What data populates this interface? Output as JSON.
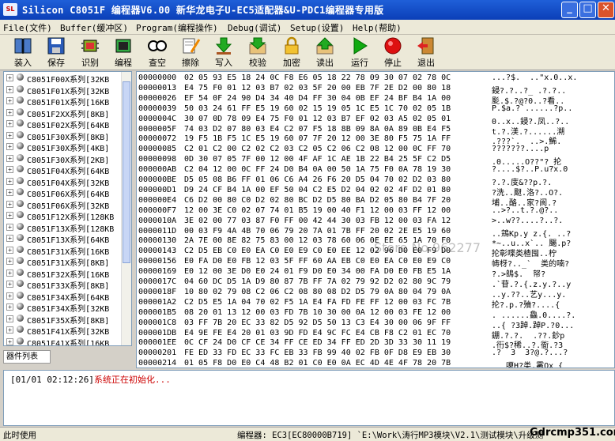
{
  "window": {
    "app_icon": "SL",
    "title": "Silicon C8051F 编程器V6.00  新华龙电子U-EC5适配器&U-PDC1编程器专用版"
  },
  "menu": [
    "File(文件)",
    "Buffer(缓冲区)",
    "Program(编程操作)",
    "Debug(调试)",
    "Setup(设置)",
    "Help(帮助)"
  ],
  "toolbar": [
    {
      "label": "装入",
      "icon": "book-icon"
    },
    {
      "label": "保存",
      "icon": "floppy-icon"
    },
    {
      "label": "识别",
      "icon": "chip-icon"
    },
    {
      "label": "编程",
      "icon": "program-icon"
    },
    {
      "label": "查空",
      "icon": "blank-check-icon"
    },
    {
      "label": "擦除",
      "icon": "erase-icon"
    },
    {
      "label": "写入",
      "icon": "write-arrow-icon"
    },
    {
      "label": "校验",
      "icon": "verify-icon"
    },
    {
      "label": "加密",
      "icon": "lock-icon"
    },
    {
      "label": "读出",
      "icon": "read-icon"
    },
    {
      "label": "运行",
      "icon": "play-icon"
    },
    {
      "label": "停止",
      "icon": "stop-icon"
    },
    {
      "label": "退出",
      "icon": "exit-door-icon"
    }
  ],
  "device_tree": [
    "C8051F00X系列[32KB",
    "C8051F01X系列[32KB",
    "C8051F01X系列[16KB",
    "C8051F2XX系列[8KB]",
    "C8051F02X系列[64KB",
    "C8051F30X系列[8KB]",
    "C8051F30X系列[4KB]",
    "C8051F30X系列[2KB]",
    "C8051F04X系列[64KB",
    "C8051F04X系列[32KB",
    "C8051F06X系列[64KB",
    "C8051F06X系列[32KB",
    "C8051F12X系列[128KB",
    "C8051F13X系列[128KB",
    "C8051F13X系列[64KB",
    "C8051F31X系列[16KB",
    "C8051F31X系列[8KB]",
    "C8051F32X系列[16KB",
    "C8051F33X系列[8KB]",
    "C8051F34X系列[64KB",
    "C8051F34X系列[32KB",
    "C8051F35X系列[8KB]",
    "C8051F41X系列[32KB",
    "C8051F41X系列[16KB"
  ],
  "panel_tab": "器件列表",
  "hex_rows": [
    {
      "addr": "00000000",
      "bytes": "02 05 93 E5 18 24 0C F8 E6 05 18 22 78 09 30 07 02 78 0C",
      "ascii": "...?$.  ..\"x.0..x."
    },
    {
      "addr": "00000013",
      "bytes": "E4 75 F0 01 12 03 B7 02 03 5F 20 00 EB 7F 2E D2 00 80 18",
      "ascii": "鋟?.?..?_ .?.?.."
    },
    {
      "addr": "00000026",
      "bytes": "EF 54 0F 24 90 D4 34 40 D4 FF 30 04 0B EF 24 BF B4 1A 00",
      "ascii": "颩.$.?@?0..?看.."
    },
    {
      "addr": "00000039",
      "bytes": "50 03 24 61 FF E5 19 60 02 15 19 05 1C E5 1C 70 02 05 1B",
      "ascii": "P.$a.?`......?p.."
    },
    {
      "addr": "0000004C",
      "bytes": "30 07 0D 78 09 E4 75 F0 01 12 03 B7 EF 02 03 A5 02 05 01",
      "ascii": "0..x..鋟?.凤..?.."
    },
    {
      "addr": "0000005F",
      "bytes": "74 03 D2 07 80 03 E4 C2 07 F5 18 8B 09 8A 0A 89 0B E4 F5",
      "ascii": "t.?.渼.?......溯"
    },
    {
      "addr": "00000072",
      "bytes": "19 F5 1B F5 1C E5 19 60 07 7F 20 12 00 3E 80 F5 75 1A FF",
      "ascii": ".???`.  ..>.鯑."
    },
    {
      "addr": "00000085",
      "bytes": "C2 01 C2 00 C2 02 C2 03 C2 05 C2 06 C2 08 12 00 0C FF 70",
      "ascii": "???????....p"
    },
    {
      "addr": "00000098",
      "bytes": "0D 30 07 05 7F 00 12 00 4F AF 1C AE 1B 22 B4 25 5F C2 D5",
      "ascii": ".0.....O??\"?_抡"
    },
    {
      "addr": "000000AB",
      "bytes": "C2 04 12 00 0C FF 24 D0 B4 0A 00 50 1A 75 F0 0A 78 19 30",
      "ascii": "?....$?..P.u?x.0"
    },
    {
      "addr": "000000BE",
      "bytes": "D5 05 08 B6 FF 01 06 C6 A4 26 F6 20 D5 04 70 02 D2 03 80",
      "ascii": "?.?.庋&??p.?."
    },
    {
      "addr": "000000D1",
      "bytes": "D9 24 CF B4 1A 00 EF 50 04 C2 E5 D2 04 02 02 4F D2 01 80",
      "ascii": "?洗..颬.洛?..O?."
    },
    {
      "addr": "000000E4",
      "bytes": "C6 D2 00 80 C0 D2 02 80 BC D2 D5 80 BA D2 05 80 B4 7F 20",
      "ascii": "埔..酪..家?阆.? "
    },
    {
      "addr": "000000F7",
      "bytes": "12 00 3E C0 02 07 74 01 B5 19 00 40 F1 12 00 03 FF 12 00",
      "ascii": "..>?..t.?.@?.."
    },
    {
      "addr": "0000010A",
      "bytes": "3E 02 00 77 03 87 F0 FF 00 42 44 30 03 FB 12 00 03 FA 12",
      "ascii": ">..w??....?..?."
    },
    {
      "addr": "0000011D",
      "bytes": "00 03 F9 4A 4B 70 06 79 20 7A 01 7B FF 20 02 2E E5 19 60",
      "ascii": "..鵍Kp.y z.{. ..?"
    },
    {
      "addr": "00000130",
      "bytes": "2A 7E 00 8E 82 75 83 00 12 03 78 60 06 0E EE 65 1A 70 F0",
      "ascii": "*~..u..x`.. 颺.p?"
    },
    {
      "addr": "00000143",
      "bytes": "C2 D5 EB C0 E0 EA C0 E0 E9 C0 E0 EE 12 02 96 D0 E0 F9 D0",
      "ascii": "抡彰喋类楂囤..柠"
    },
    {
      "addr": "00000156",
      "bytes": "E0 FA D0 E0 FB 12 03 5F FF 60 AA EB C0 E0 EA C0 E0 E9 C0",
      "ascii": "帱枒?.._`  类的喃?"
    },
    {
      "addr": "00000169",
      "bytes": "E0 12 00 3E D0 E0 24 01 F9 D0 E0 34 00 FA D0 E0 FB E5 1A",
      "ascii": "?.>鴭$.  帑?"
    },
    {
      "addr": "0000017C",
      "bytes": "04 60 DC D5 1A D9 80 87 7B FF 7A 02 79 92 D2 02 80 9C 79",
      "ascii": ".`苷.?.{.z.y.?..y"
    },
    {
      "addr": "0000018F",
      "bytes": "10 80 02 79 08 C2 06 C2 08 80 08 D2 D5 79 0A 80 04 79 0A",
      "ascii": "..y.??..艺y...y."
    },
    {
      "addr": "000001A2",
      "bytes": "C2 D5 E5 1A 04 70 02 F5 1A E4 FA FD FE FF 12 00 03 FC 7B",
      "ascii": "抡?.p.?殰?....{"
    },
    {
      "addr": "000001B5",
      "bytes": "08 20 01 13 12 00 03 FD 7B 10 30 00 0A 12 00 03 FE 12 00",
      "ascii": ". ......鱻.0....?."
    },
    {
      "addr": "000001C8",
      "bytes": "03 FF 7B 20 EC 33 82 D5 92 D5 50 13 C3 E4 30 00 06 9F FF",
      "ascii": "..{ ?3踔.踔P.?0..."
    },
    {
      "addr": "000001DB",
      "bytes": "E4 9E FE E4 20 01 03 9D FD E4 9C FC E4 CB F8 C2 01 EC 70",
      "ascii": "錋.?.?.  .??.鈔p"
    },
    {
      "addr": "000001EE",
      "bytes": "0C CF 24 D0 CF CE 34 FF CE ED 34 FF ED 2D 3D 33 30 11 19",
      "ascii": ".衎$?稀..?.衜.?3"
    },
    {
      "addr": "00000201",
      "bytes": "FE ED 33 FD EC 33 FC EB 33 FB 99 40 02 FB 0F D8 E9 EB 30",
      "ascii": ".?  3  3?@.?...?"
    },
    {
      "addr": "00000214",
      "bytes": "01 05 F8 D0 E0 C4 48 B2 01 C0 E0 0A EC 4D 4E 4F 78 20 7B",
      "ascii": "   嗄H?类.霱Ox {"
    }
  ],
  "watermark": "Store No.962277",
  "log": {
    "time": "[01/01 02:12:26]",
    "message": "系统正在初始化..."
  },
  "status": {
    "left": "此时使用",
    "right": "编程器: EC3[EC80000B719]  `E:\\Work\\涛行MP3模块\\V2.1\\测试模块\\升级测",
    "mark": "Gdrcmp351.com"
  }
}
